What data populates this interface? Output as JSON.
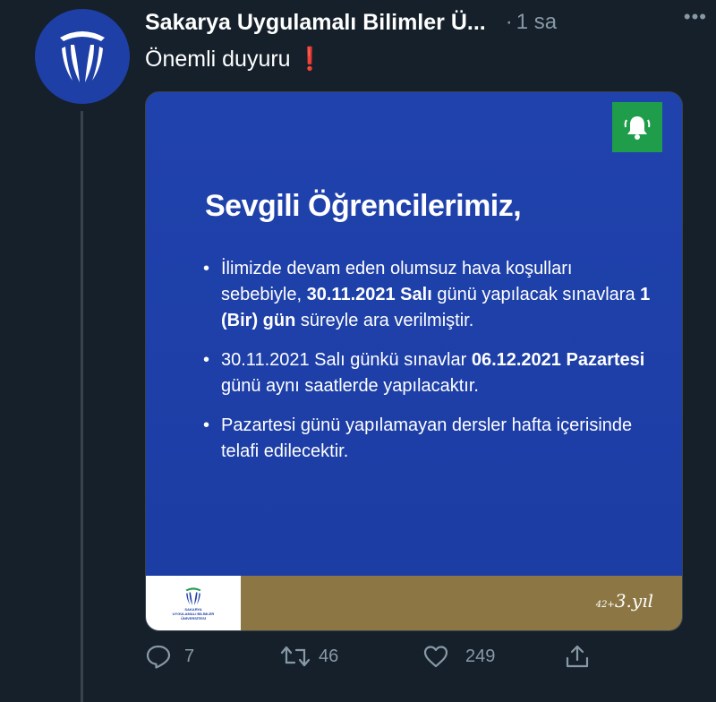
{
  "tweet": {
    "author_name": "Sakarya Uygulamalı Bilimler Ü...",
    "separator": "·",
    "time": "1 sa",
    "more_label": "•••",
    "text": "Önemli duyuru",
    "text_emoji": "❗"
  },
  "card": {
    "title": "Sevgili Öğrencilerimiz,",
    "bullet1": {
      "part1": "İlimizde devam eden olumsuz hava koşulları sebebiyle, ",
      "bold1": "30.11.2021 Salı",
      "part2": " günü yapılacak sınavlara ",
      "bold2": "1 (Bir) gün",
      "part3": " süreyle ara verilmiştir."
    },
    "bullet2": {
      "part1": "30.11.2021 Salı günkü sınavlar ",
      "bold1": "06.12.2021 Pazartesi",
      "part2": " günü aynı saatlerde yapılacaktır."
    },
    "bullet3": {
      "part1": "Pazartesi günü yapılamayan dersler hafta içerisinde telafi edilecektir."
    },
    "footer_logo_text": [
      "SAKARYA",
      "UYGULAMALI BİLİMLER",
      "ÜNİVERSİTESİ"
    ],
    "year_mark_small": "42+",
    "year_mark": "3.yıl",
    "colors": {
      "card_blue": "#1f3fa6",
      "bell_green": "#1f9d4a",
      "footer_gold": "#8c7744"
    }
  },
  "actions": {
    "reply_count": "7",
    "retweet_count": "46",
    "like_count": "249"
  },
  "icons": [
    "university-logo-icon",
    "bell-icon",
    "reply-icon",
    "retweet-icon",
    "like-icon",
    "share-icon"
  ]
}
